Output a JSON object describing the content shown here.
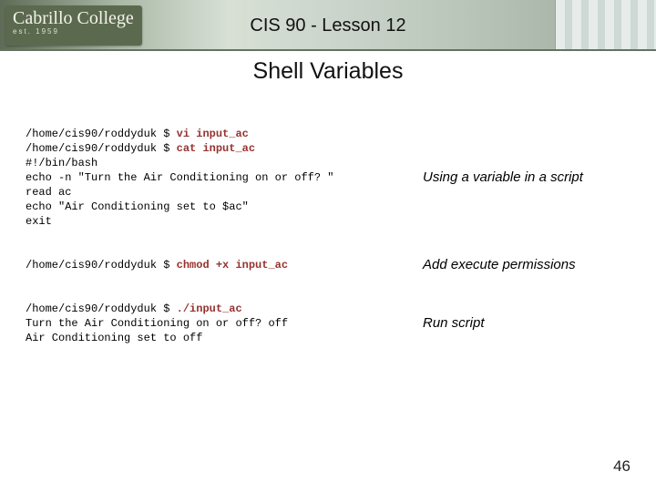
{
  "header": {
    "logo_main": "Cabrillo College",
    "logo_sub": "est. 1959",
    "title": "CIS 90 - Lesson 12"
  },
  "section_title": "Shell Variables",
  "blocks": [
    {
      "code": [
        {
          "plain": "/home/cis90/roddyduk $ ",
          "cmd": "vi input_ac"
        },
        {
          "plain": "/home/cis90/roddyduk $ ",
          "cmd": "cat input_ac"
        },
        {
          "plain": "#!/bin/bash"
        },
        {
          "plain": "echo -n \"Turn the Air Conditioning on or off? \""
        },
        {
          "plain": "read ac"
        },
        {
          "plain": "echo \"Air Conditioning set to $ac\""
        },
        {
          "plain": "exit"
        }
      ],
      "note": "Using a variable in a script"
    },
    {
      "code": [
        {
          "plain": "/home/cis90/roddyduk $ ",
          "cmd": "chmod +x input_ac"
        }
      ],
      "note": "Add execute permissions"
    },
    {
      "code": [
        {
          "plain": "/home/cis90/roddyduk $ ",
          "cmd": "./input_ac"
        },
        {
          "plain": "Turn the Air Conditioning on or off? off"
        },
        {
          "plain": "Air Conditioning set to off"
        }
      ],
      "note": "Run script"
    }
  ],
  "page_number": "46"
}
